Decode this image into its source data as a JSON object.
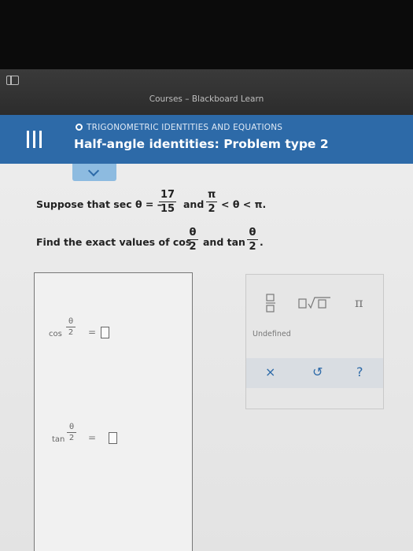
{
  "browser": {
    "title": "Courses – Blackboard Learn"
  },
  "header": {
    "topic": "TRIGONOMETRIC IDENTITIES AND EQUATIONS",
    "problem_title": "Half-angle identities: Problem type 2"
  },
  "question": {
    "line1_prefix": "Suppose that sec θ = –",
    "sec_num": "17",
    "sec_den": "15",
    "and": "and",
    "pi_num": "π",
    "pi_den": "2",
    "ineq": "< θ < π.",
    "line2_prefix": "Find the exact values of cos",
    "half_num": "θ",
    "half_den": "2",
    "and_tan": "and tan",
    "period": "."
  },
  "answers": {
    "cos_label": "cos",
    "tan_label": "tan",
    "theta": "θ",
    "two": "2",
    "equals": "="
  },
  "palette": {
    "undefined_label": "Undefined",
    "pi_symbol": "π",
    "clear_symbol": "×",
    "undo_symbol": "↺",
    "help_symbol": "?",
    "accent_color": "#2d6aa8"
  }
}
